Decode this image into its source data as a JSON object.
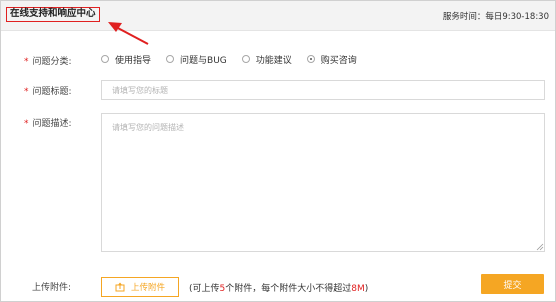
{
  "header": {
    "title": "在线支持和响应中心",
    "service_hours": "服务时间：每日9:30-18:30"
  },
  "form": {
    "category": {
      "required_mark": "*",
      "label": "问题分类:",
      "options": [
        {
          "label": "使用指导",
          "checked": false
        },
        {
          "label": "问题与BUG",
          "checked": false
        },
        {
          "label": "功能建议",
          "checked": false
        },
        {
          "label": "购买咨询",
          "checked": true
        }
      ]
    },
    "subject": {
      "required_mark": "*",
      "label": "问题标题:",
      "value": "",
      "placeholder": "请填写您的标题"
    },
    "description": {
      "required_mark": "*",
      "label": "问题描述:",
      "value": "",
      "placeholder": "请填写您的问题描述"
    },
    "attachment": {
      "label": "上传附件:",
      "button_label": "上传附件",
      "hint_prefix": "(可上传",
      "hint_count": "5",
      "hint_middle": "个附件，每个附件大小不得超过",
      "hint_size": "8M",
      "hint_suffix": ")"
    },
    "submit_label": "提交"
  },
  "colors": {
    "accent": "#f5a623",
    "required": "#e02020",
    "highlight_box": "#e02020",
    "header_bg": "#f3f3f3"
  },
  "icons": {
    "annotation_arrow": "red-arrow-icon",
    "upload": "upload-icon",
    "resize": "resize-grip-icon"
  }
}
